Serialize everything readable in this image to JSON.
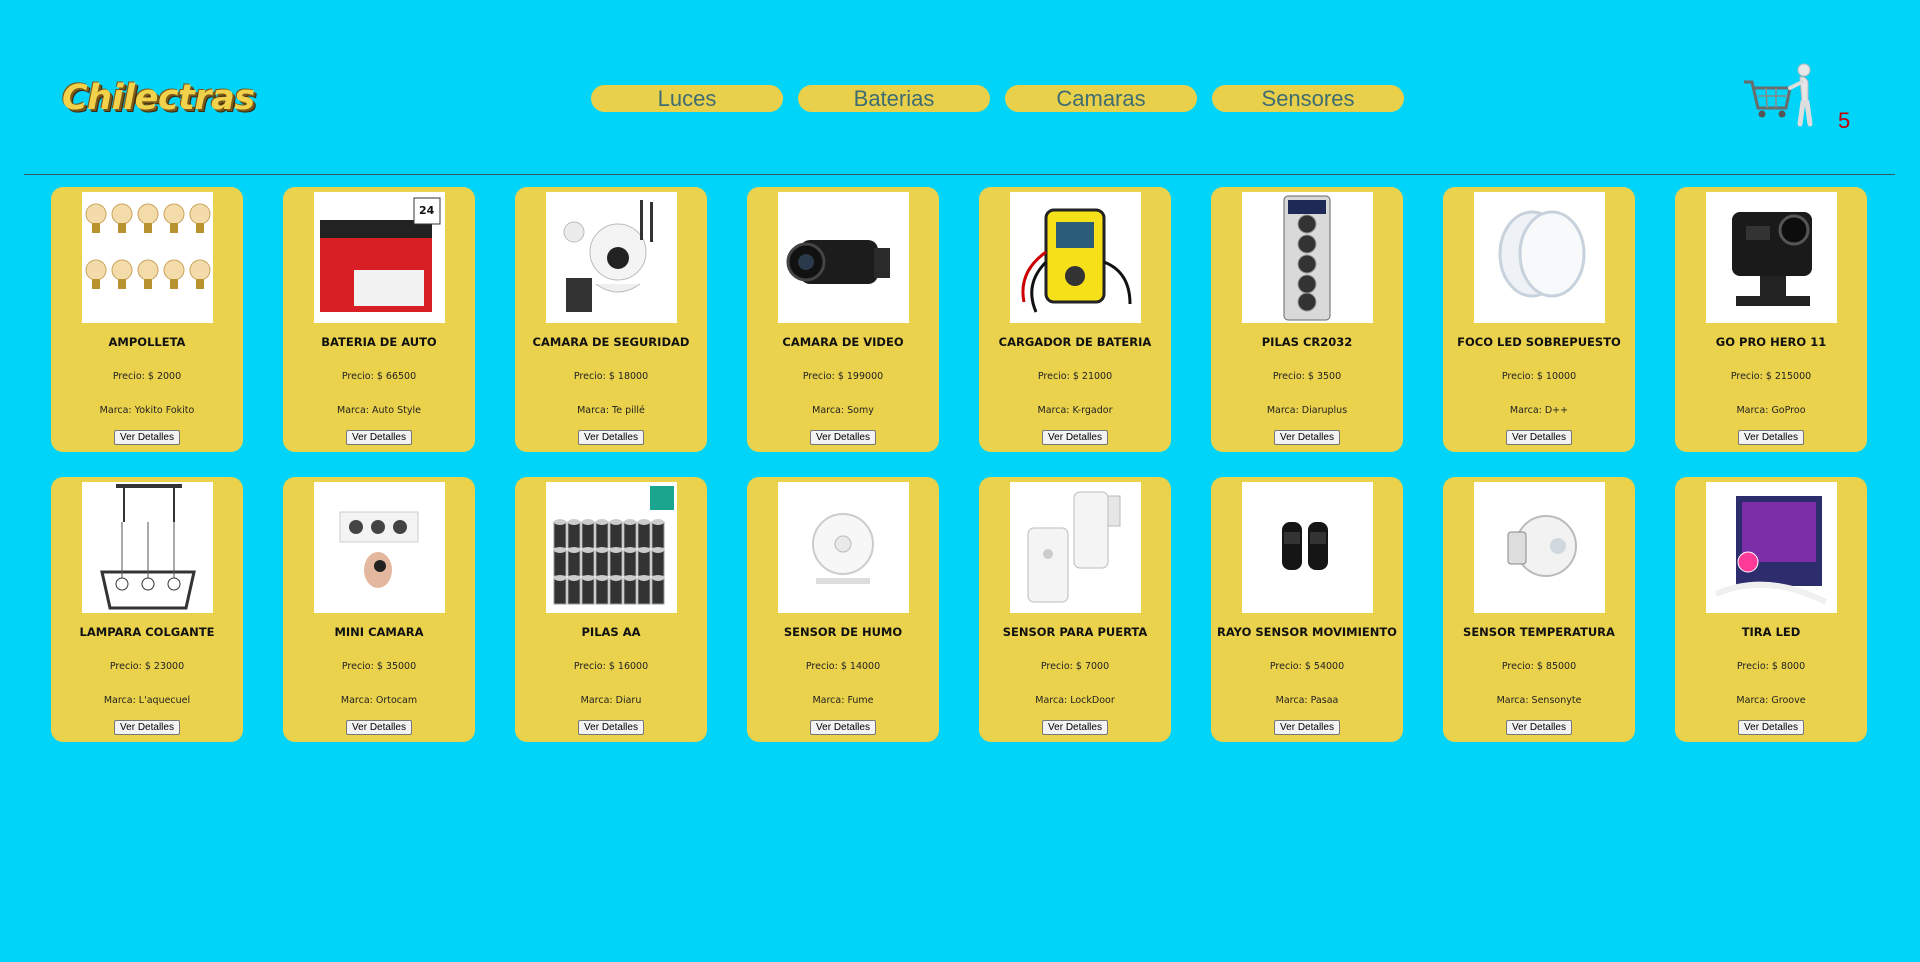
{
  "header": {
    "logo": "Chilectras",
    "nav": [
      "Luces",
      "Baterias",
      "Camaras",
      "Sensores"
    ],
    "cart_count": "5"
  },
  "products": [
    {
      "name": "AMPOLLETA",
      "price": "Precio: $ 2000",
      "brand": "Marca: Yokito Fokito",
      "button": "Ver Detalles",
      "icon": "bulbs-icon"
    },
    {
      "name": "BATERIA DE AUTO",
      "price": "Precio: $ 66500",
      "brand": "Marca: Auto Style",
      "button": "Ver Detalles",
      "icon": "car-battery-icon"
    },
    {
      "name": "CAMARA DE SEGURIDAD",
      "price": "Precio: $ 18000",
      "brand": "Marca: Te pillé",
      "button": "Ver Detalles",
      "icon": "security-camera-icon"
    },
    {
      "name": "CAMARA DE VIDEO",
      "price": "Precio: $ 199000",
      "brand": "Marca: Somy",
      "button": "Ver Detalles",
      "icon": "video-camera-icon"
    },
    {
      "name": "CARGADOR DE BATERIA",
      "price": "Precio: $ 21000",
      "brand": "Marca: K-rgador",
      "button": "Ver Detalles",
      "icon": "battery-charger-icon"
    },
    {
      "name": "PILAS CR2032",
      "price": "Precio: $ 3500",
      "brand": "Marca: Diaruplus",
      "button": "Ver Detalles",
      "icon": "coin-cells-icon"
    },
    {
      "name": "FOCO LED SOBREPUESTO",
      "price": "Precio: $ 10000",
      "brand": "Marca: D++",
      "button": "Ver Detalles",
      "icon": "led-panel-icon"
    },
    {
      "name": "GO PRO HERO 11",
      "price": "Precio: $ 215000",
      "brand": "Marca: GoProo",
      "button": "Ver Detalles",
      "icon": "action-camera-icon"
    },
    {
      "name": "LAMPARA COLGANTE",
      "price": "Precio: $ 23000",
      "brand": "Marca: L'aquecuel",
      "button": "Ver Detalles",
      "icon": "pendant-lamp-icon"
    },
    {
      "name": "MINI CAMARA",
      "price": "Precio: $ 35000",
      "brand": "Marca: Ortocam",
      "button": "Ver Detalles",
      "icon": "mini-camera-icon"
    },
    {
      "name": "PILAS AA",
      "price": "Precio: $ 16000",
      "brand": "Marca: Diaru",
      "button": "Ver Detalles",
      "icon": "aa-batteries-icon"
    },
    {
      "name": "SENSOR DE HUMO",
      "price": "Precio: $ 14000",
      "brand": "Marca: Fume",
      "button": "Ver Detalles",
      "icon": "smoke-sensor-icon"
    },
    {
      "name": "SENSOR PARA PUERTA",
      "price": "Precio: $ 7000",
      "brand": "Marca: LockDoor",
      "button": "Ver Detalles",
      "icon": "door-sensor-icon"
    },
    {
      "name": "RAYO SENSOR MOVIMIENTO",
      "price": "Precio: $ 54000",
      "brand": "Marca: Pasaa",
      "button": "Ver Detalles",
      "icon": "motion-beam-sensor-icon"
    },
    {
      "name": "SENSOR TEMPERATURA",
      "price": "Precio: $ 85000",
      "brand": "Marca: Sensonyte",
      "button": "Ver Detalles",
      "icon": "temperature-sensor-icon"
    },
    {
      "name": "TIRA LED",
      "price": "Precio: $ 8000",
      "brand": "Marca: Groove",
      "button": "Ver Detalles",
      "icon": "led-strip-icon"
    }
  ],
  "colors": {
    "background": "#00d4f9",
    "card": "#ead24c",
    "nav_button": "#e9d04a",
    "nav_text": "#3d6d73",
    "cart_count": "#c40000"
  }
}
